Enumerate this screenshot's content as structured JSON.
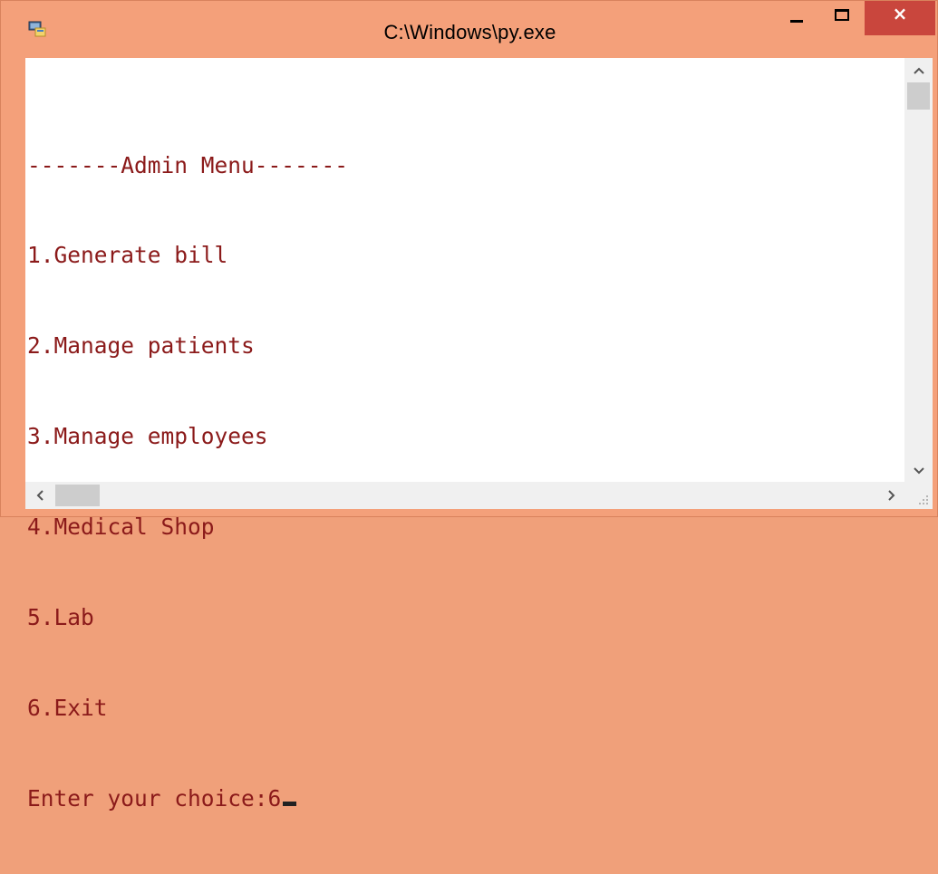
{
  "window": {
    "title": "C:\\Windows\\py.exe",
    "accent_color": "#f4a07a",
    "close_color": "#c9463d",
    "close_glyph": "×"
  },
  "console": {
    "text_color": "#8b1a1a",
    "lines": [
      "-------Admin Menu-------",
      "1.Generate bill",
      "2.Manage patients",
      "3.Manage employees",
      "4.Medical Shop",
      "5.Lab",
      "6.Exit"
    ],
    "prompt": "Enter your choice:",
    "input_value": "6"
  },
  "icons": {
    "app": "console-app-icon",
    "minimize": "minimize-icon",
    "maximize": "maximize-icon",
    "close": "close-icon",
    "scroll_up": "chevron-up-icon",
    "scroll_down": "chevron-down-icon",
    "scroll_left": "chevron-left-icon",
    "scroll_right": "chevron-right-icon",
    "resize_grip": "resize-grip-icon"
  }
}
